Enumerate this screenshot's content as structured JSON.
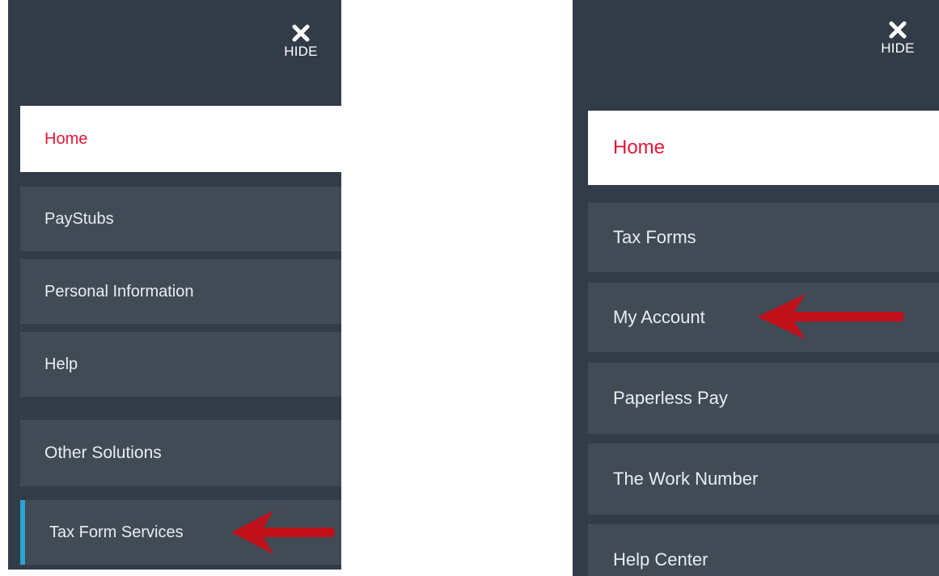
{
  "left_panel": {
    "hide_label": "HIDE",
    "menu": {
      "home": "Home",
      "paystubs": "PayStubs",
      "personal_information": "Personal Information",
      "help": "Help",
      "other_solutions": "Other Solutions",
      "tax_form_services": "Tax Form Services"
    }
  },
  "right_panel": {
    "hide_label": "HIDE",
    "menu": {
      "home": "Home",
      "tax_forms": "Tax Forms",
      "my_account": "My Account",
      "paperless_pay": "Paperless Pay",
      "work_number": "The Work Number",
      "help_center": "Help Center"
    }
  },
  "icons": {
    "hide": "close-x-icon",
    "annotation": "red-arrow-icon"
  },
  "colors": {
    "panel_bg": "#323c48",
    "item_bg": "#404b56",
    "home_text": "#e2173a",
    "active_accent": "#2ba3d6",
    "arrow": "#c0101a"
  }
}
